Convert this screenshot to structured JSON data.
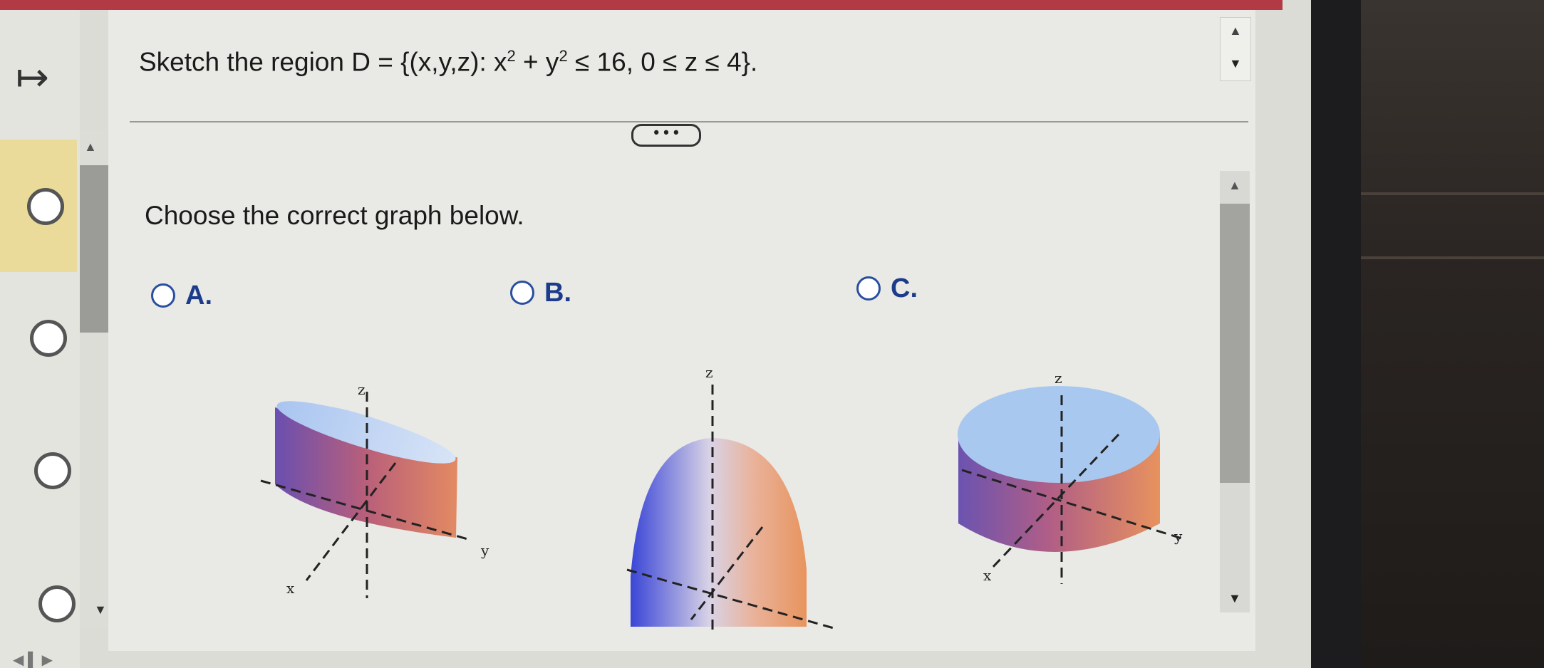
{
  "nav": {
    "expand_icon": "arrow-right-from-bar-icon",
    "expand_glyph": "↦"
  },
  "question": {
    "prefix": "Sketch the region D = {(x,y,z): x",
    "exp1": "2",
    "mid": " + y",
    "exp2": "2",
    "suffix": " ≤ 16, 0 ≤ z ≤ 4}."
  },
  "more_button": {
    "label": "• • •"
  },
  "instruction": "Choose the correct graph below.",
  "options": [
    {
      "label": "A.",
      "axes": {
        "x": "x",
        "y": "y",
        "z": "z"
      }
    },
    {
      "label": "B.",
      "axes": {
        "z": "z"
      }
    },
    {
      "label": "C.",
      "axes": {
        "x": "x",
        "y": "y",
        "z": "z"
      }
    }
  ],
  "colors": {
    "accent": "#2a4fa0",
    "selected_panel": "#eadb9a",
    "header_bar": "#b23a45"
  }
}
